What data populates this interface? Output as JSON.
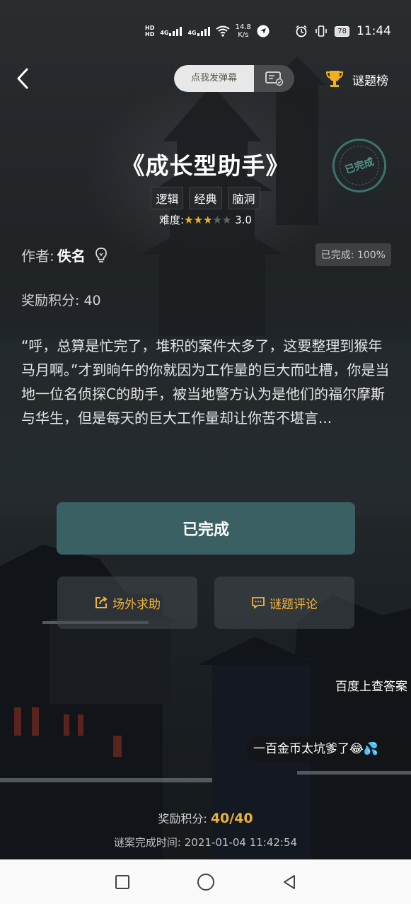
{
  "status_bar": {
    "hd1": "HD",
    "hd2": "HD",
    "sig1": "4G",
    "sig2": "4G",
    "speed_value": "14.8",
    "speed_unit": "K/s",
    "battery": "78",
    "time": "11:44"
  },
  "header": {
    "danmu_placeholder": "点我发弹幕",
    "rank_label": "谜题榜"
  },
  "puzzle": {
    "title": "《成长型助手》",
    "stamp": "已完成",
    "tags": [
      "逻辑",
      "经典",
      "脑洞"
    ],
    "difficulty_label": "难度:",
    "difficulty_rating": 3,
    "difficulty_max": 5,
    "difficulty_value": "3.0",
    "author_label": "作者:",
    "author_name": "佚名",
    "completion_badge": "已完成: 100%",
    "reward_text": "奖励积分:  40",
    "description": "“呼，总算是忙完了，堆积的案件太多了，这要整理到猴年马月啊。”才到晌午的你就因为工作量的巨大而吐槽，你是当地一位名侦探C的助手，被当地警方认为是他们的福尔摩斯与华生，但是每天的巨大工作量却让你苦不堪言..."
  },
  "actions": {
    "done_label": "已完成",
    "help_label": "场外求助",
    "comment_label": "谜题评论"
  },
  "danmaku": [
    "百度上查答案",
    "一百金币太坑爹了😂💦"
  ],
  "footer": {
    "reward_label": "奖励积分:",
    "reward_value": "40/40",
    "time_label": "谜案完成时间:",
    "time_value": "2021-01-04 11:42:54"
  },
  "colors": {
    "accent_gold": "#e7b13a",
    "done_button": "#3a6064",
    "star": "#f2b01e"
  }
}
